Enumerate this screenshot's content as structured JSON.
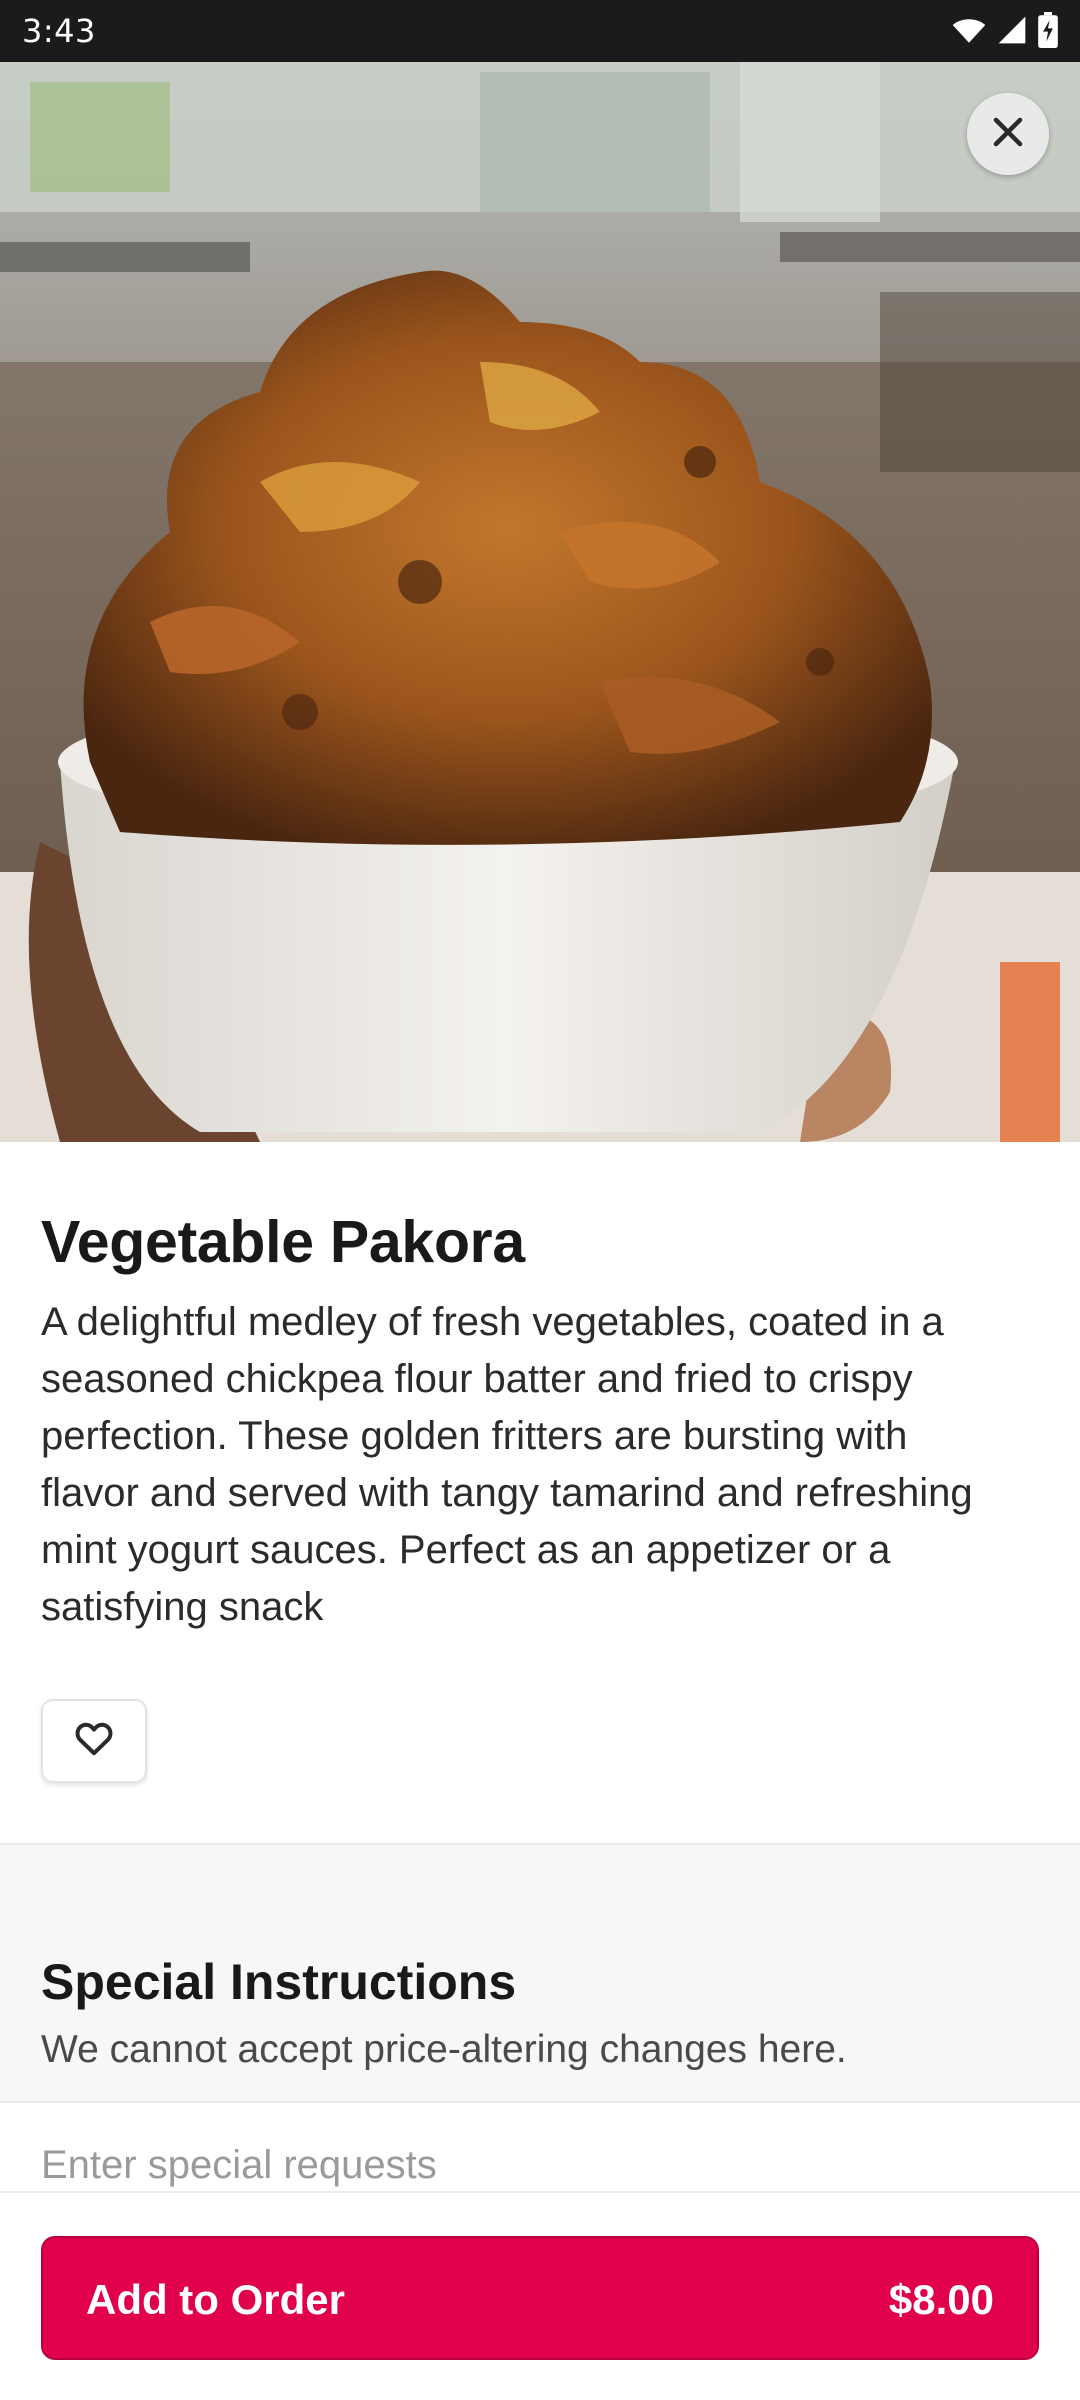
{
  "status_bar": {
    "time": "3:43",
    "icons": [
      "wifi-icon",
      "cellular-signal-icon",
      "battery-charging-icon"
    ]
  },
  "hero": {
    "image": "vegetable-pakora-photo",
    "close_icon": "close-icon"
  },
  "item": {
    "title": "Vegetable Pakora",
    "description": "A delightful medley of fresh vegetables, coated in a seasoned chickpea flour batter and fried to crispy perfection. These golden fritters are bursting with flavor and served with tangy tamarind and refreshing mint yogurt sauces. Perfect as an appetizer or a satisfying snack",
    "favorite_icon": "heart-outline-icon"
  },
  "special_instructions": {
    "title": "Special Instructions",
    "subtitle": "We cannot accept price-altering changes here.",
    "input_value": "",
    "input_placeholder": "Enter special requests"
  },
  "order_button": {
    "label": "Add to Order",
    "price": "$8.00"
  },
  "colors": {
    "accent": "#e0004d",
    "status_bar_bg": "#1b1b1d",
    "section_bg": "#f7f7f7"
  }
}
